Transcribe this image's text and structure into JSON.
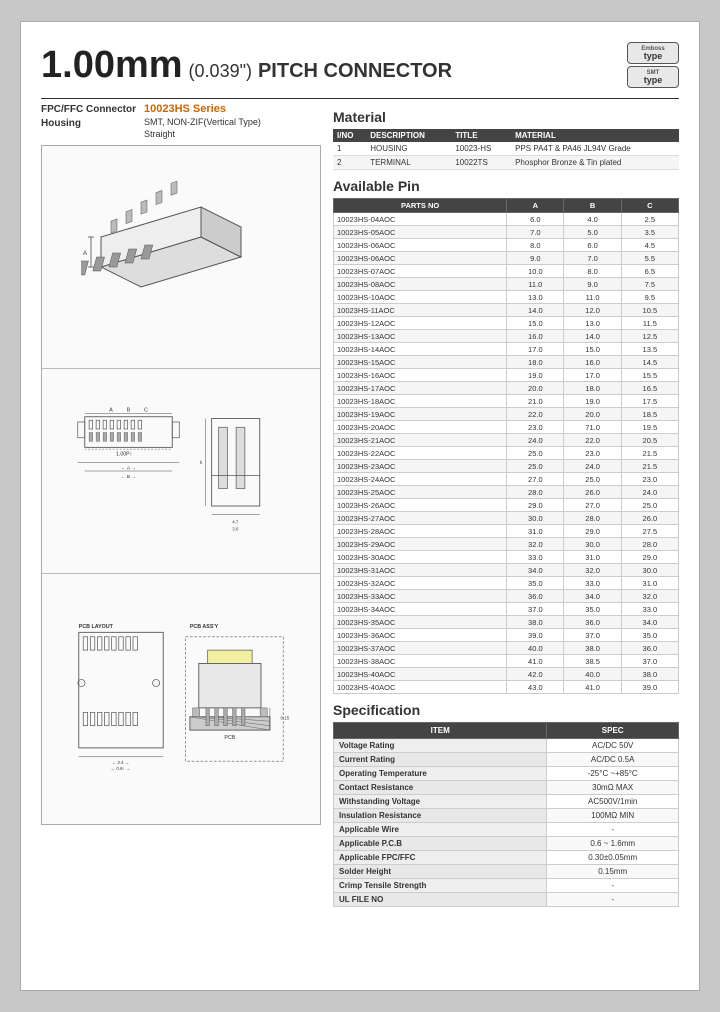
{
  "header": {
    "pitch": "1.00mm",
    "pitch_fraction": "(0.039\")",
    "connector_text": "PITCH CONNECTOR",
    "badge1_top": "Emboss",
    "badge1_bottom": "type",
    "badge2_top": "SMT",
    "badge2_bottom": "type"
  },
  "product": {
    "category_label": "FPC/FFC Connector\nHousing",
    "series": "10023HS Series",
    "type": "SMT, NON-ZIF(Vertical Type)",
    "orientation": "Straight"
  },
  "material": {
    "title": "Material",
    "headers": [
      "I/NO",
      "DESCRIPTION",
      "TITLE",
      "MATERIAL"
    ],
    "rows": [
      [
        "1",
        "HOUSING",
        "10023-HS",
        "PPS PA4T & PA46 JL94V Grade"
      ],
      [
        "2",
        "TERMINAL",
        "10022TS",
        "Phosphor Bronze & Tin plated"
      ]
    ]
  },
  "available_pin": {
    "title": "Available Pin",
    "headers": [
      "PARTS NO",
      "A",
      "B",
      "C"
    ],
    "rows": [
      [
        "10023HS-04AOC",
        "6.0",
        "4.0",
        "2.5"
      ],
      [
        "10023HS-05AOC",
        "7.0",
        "5.0",
        "3.5"
      ],
      [
        "10023HS-06AOC",
        "8.0",
        "6.0",
        "4.5"
      ],
      [
        "10023HS-06AOC",
        "9.0",
        "7.0",
        "5.5"
      ],
      [
        "10023HS-07AOC",
        "10.0",
        "8.0",
        "6.5"
      ],
      [
        "10023HS-08AOC",
        "11.0",
        "9.0",
        "7.5"
      ],
      [
        "10023HS-10AOC",
        "13.0",
        "11.0",
        "9.5"
      ],
      [
        "10023HS-11AOC",
        "14.0",
        "12.0",
        "10.5"
      ],
      [
        "10023HS-12AOC",
        "15.0",
        "13.0",
        "11.5"
      ],
      [
        "10023HS-13AOC",
        "16.0",
        "14.0",
        "12.5"
      ],
      [
        "10023HS-14AOC",
        "17.0",
        "15.0",
        "13.5"
      ],
      [
        "10023HS-15AOC",
        "18.0",
        "16.0",
        "14.5"
      ],
      [
        "10023HS-16AOC",
        "19.0",
        "17.0",
        "15.5"
      ],
      [
        "10023HS-17AOC",
        "20.0",
        "18.0",
        "16.5"
      ],
      [
        "10023HS-18AOC",
        "21.0",
        "19.0",
        "17.5"
      ],
      [
        "10023HS-19AOC",
        "22.0",
        "20.0",
        "18.5"
      ],
      [
        "10023HS-20AOC",
        "23.0",
        "71.0",
        "19.5"
      ],
      [
        "10023HS-21AOC",
        "24.0",
        "22.0",
        "20.5"
      ],
      [
        "10023HS-22AOC",
        "25.0",
        "23.0",
        "21.5"
      ],
      [
        "10023HS-23AOC",
        "25.0",
        "24.0",
        "21.5"
      ],
      [
        "10023HS-24AOC",
        "27.0",
        "25.0",
        "23.0"
      ],
      [
        "10023HS-25AOC",
        "28.0",
        "26.0",
        "24.0"
      ],
      [
        "10023HS-26AOC",
        "29.0",
        "27.0",
        "25.0"
      ],
      [
        "10023HS-27AOC",
        "30.0",
        "28.0",
        "26.0"
      ],
      [
        "10023HS-28AOC",
        "31.0",
        "29.0",
        "27.5"
      ],
      [
        "10023HS-29AOC",
        "32.0",
        "30.0",
        "28.0"
      ],
      [
        "10023HS-30AOC",
        "33.0",
        "31.0",
        "29.0"
      ],
      [
        "10023HS-31AOC",
        "34.0",
        "32.0",
        "30.0"
      ],
      [
        "10023HS-32AOC",
        "35.0",
        "33.0",
        "31.0"
      ],
      [
        "10023HS-33AOC",
        "36.0",
        "34.0",
        "32.0"
      ],
      [
        "10023HS-34AOC",
        "37.0",
        "35.0",
        "33.0"
      ],
      [
        "10023HS-35AOC",
        "38.0",
        "36.0",
        "34.0"
      ],
      [
        "10023HS-36AOC",
        "39.0",
        "37.0",
        "35.0"
      ],
      [
        "10023HS-37AOC",
        "40.0",
        "38.0",
        "36.0"
      ],
      [
        "10023HS-38AOC",
        "41.0",
        "38.5",
        "37.0"
      ],
      [
        "10023HS-40AOC",
        "42.0",
        "40.0",
        "38.0"
      ],
      [
        "10023HS-40AOC",
        "43.0",
        "41.0",
        "39.0"
      ]
    ]
  },
  "specification": {
    "title": "Specification",
    "headers": [
      "ITEM",
      "SPEC"
    ],
    "rows": [
      [
        "Voltage Rating",
        "AC/DC 50V"
      ],
      [
        "Current Rating",
        "AC/DC 0.5A"
      ],
      [
        "Operating Temperature",
        "-25°C ~+85°C"
      ],
      [
        "Contact Resistance",
        "30mΩ MAX"
      ],
      [
        "Withstanding Voltage",
        "AC500V/1min"
      ],
      [
        "Insulation Resistance",
        "100MΩ MIN"
      ],
      [
        "Applicable Wire",
        "-"
      ],
      [
        "Applicable P.C.B",
        "0.6 ~ 1.6mm"
      ],
      [
        "Applicable FPC/FFC",
        "0.30±0.05mm"
      ],
      [
        "Solder Height",
        "0.15mm"
      ],
      [
        "Crimp Tensile Strength",
        "-"
      ],
      [
        "UL FILE NO",
        "-"
      ]
    ]
  },
  "pcb_labels": {
    "layout": "PCB LAYOUT",
    "assy": "PCB ASS'Y"
  }
}
